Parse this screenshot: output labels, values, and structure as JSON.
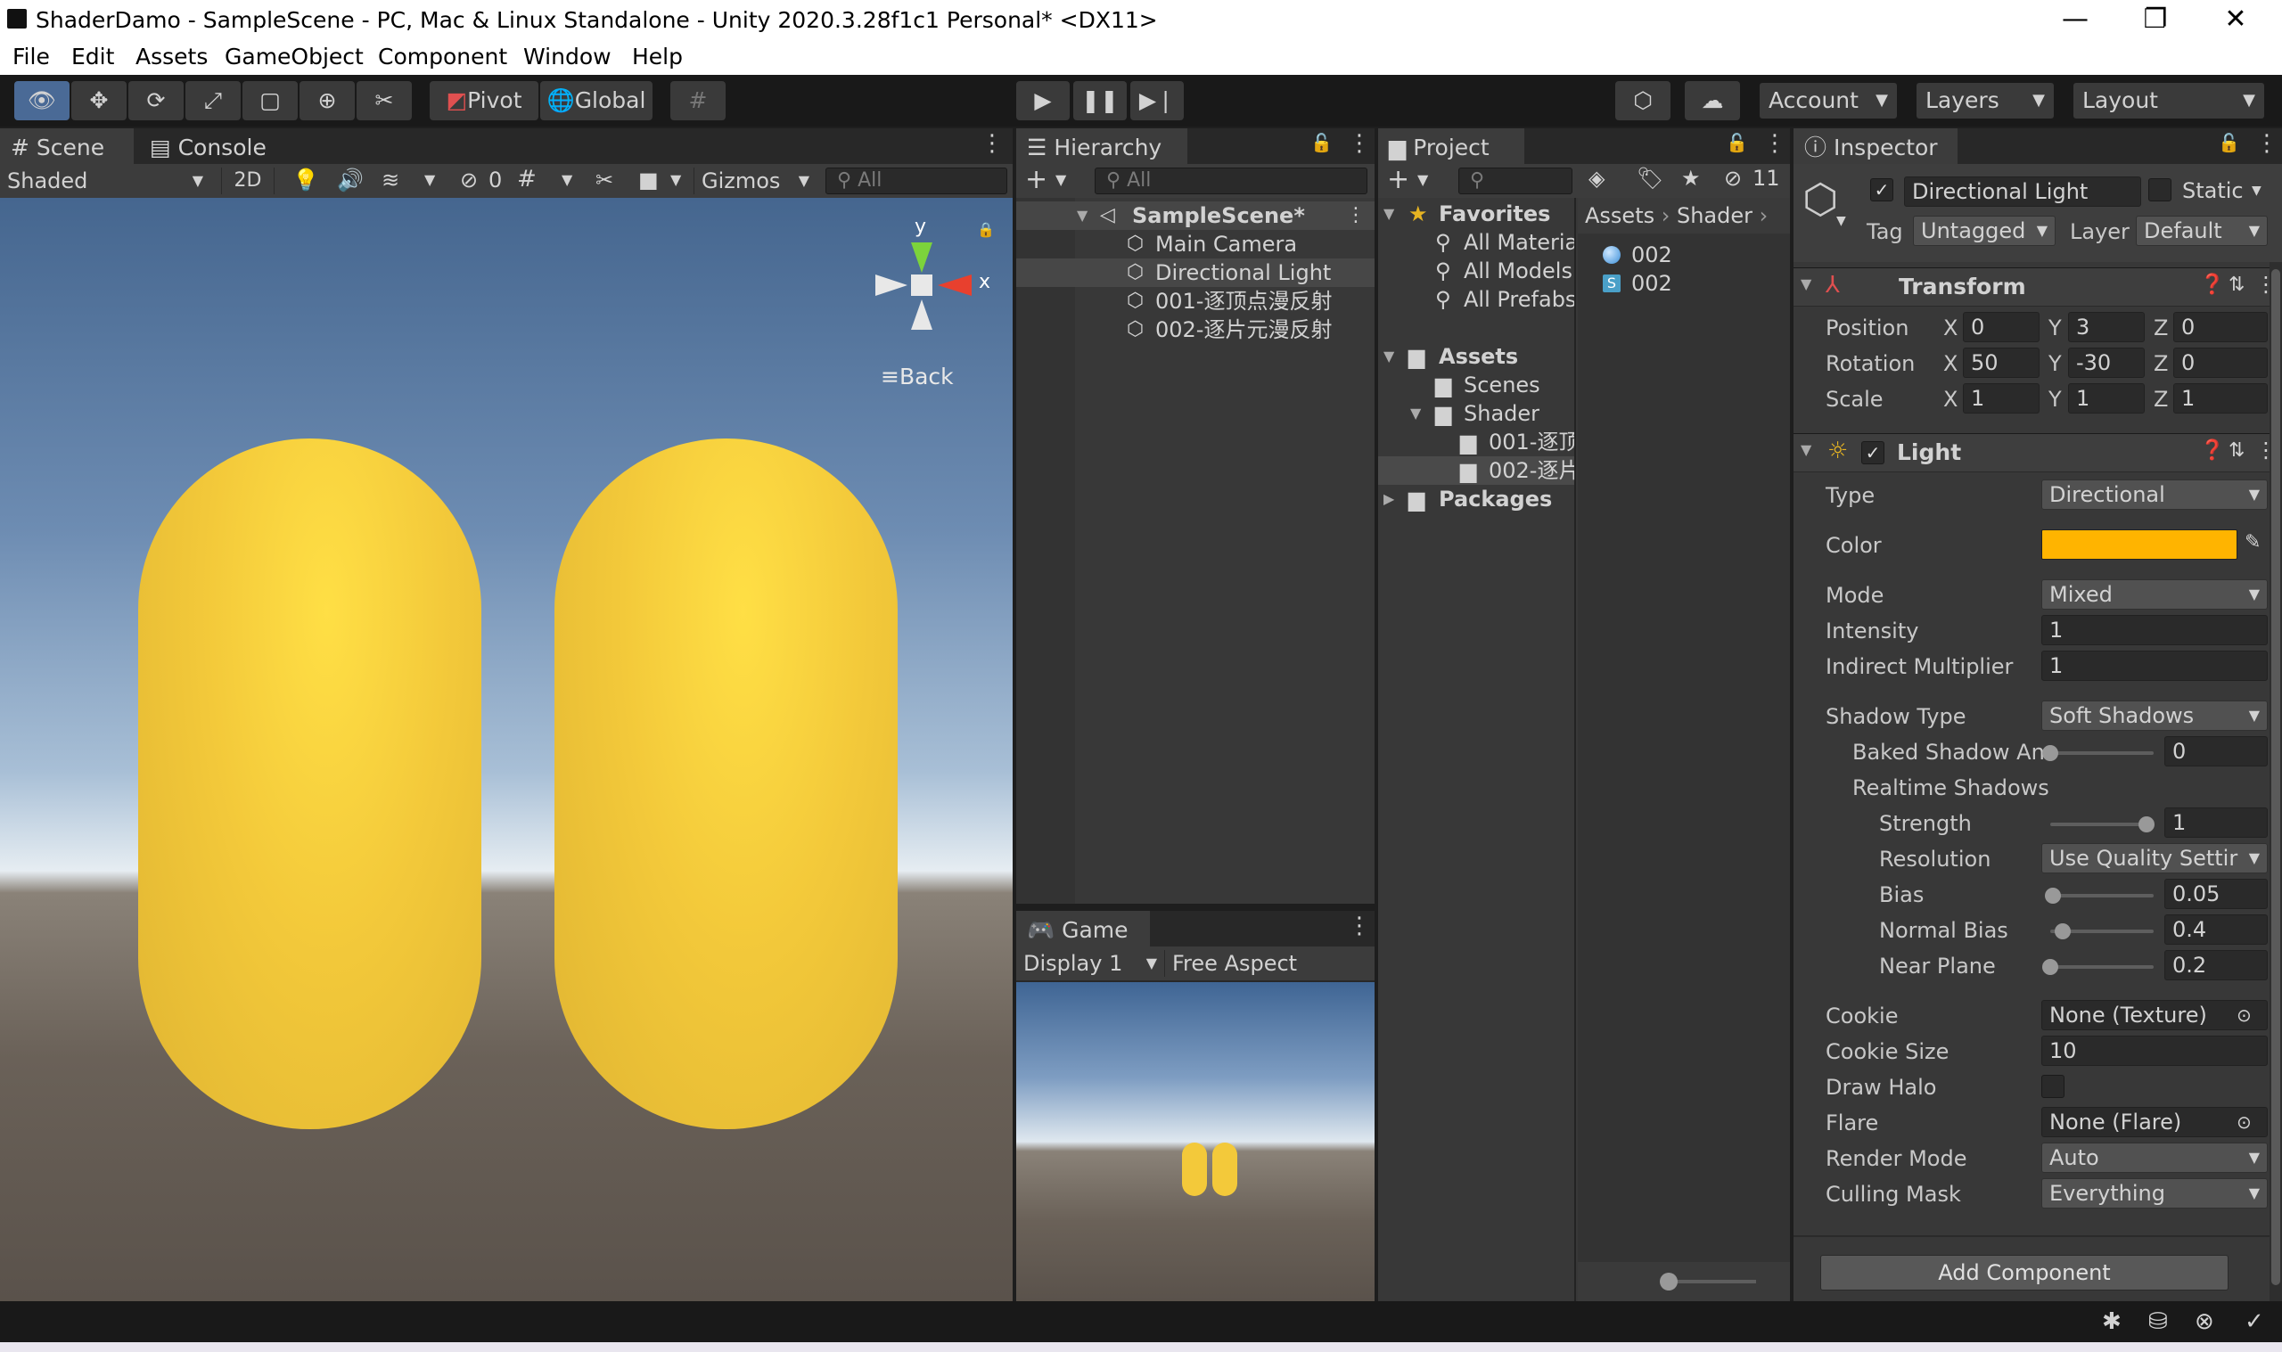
{
  "window": {
    "title": "ShaderDamo - SampleScene - PC, Mac & Linux Standalone - Unity 2020.3.28f1c1 Personal* <DX11>",
    "minimize": "—",
    "maximize": "❐",
    "close": "✕"
  },
  "menu": [
    "File",
    "Edit",
    "Assets",
    "GameObject",
    "Component",
    "Window",
    "Help"
  ],
  "toolbar": {
    "pivot": "Pivot",
    "global": "Global",
    "account": "Account",
    "layers": "Layers",
    "layout": "Layout"
  },
  "scene_panel": {
    "tab_scene": "Scene",
    "tab_console": "Console",
    "shading": "Shaded",
    "mode_2d": "2D",
    "hidden_count": "0",
    "gizmos": "Gizmos",
    "search_placeholder": "All",
    "gizmo_y": "y",
    "gizmo_x": "x",
    "view_label": "Back",
    "capsule_color": "#f5c93a"
  },
  "hierarchy": {
    "tab": "Hierarchy",
    "search_placeholder": "All",
    "scene": "SampleScene*",
    "items": [
      "Main Camera",
      "Directional Light",
      "001-逐顶点漫反射",
      "002-逐片元漫反射"
    ]
  },
  "game_panel": {
    "tab": "Game",
    "display": "Display 1",
    "aspect": "Free Aspect"
  },
  "project": {
    "tab": "Project",
    "hidden_count": "11",
    "favorites": "Favorites",
    "favorite_items": [
      "All Materia",
      "All Models",
      "All Prefabs"
    ],
    "assets": "Assets",
    "asset_folders": [
      "Scenes",
      "Shader"
    ],
    "shader_folders": [
      "001-逐顶",
      "002-逐片"
    ],
    "packages": "Packages",
    "breadcrumb": [
      "Assets",
      "Shader"
    ],
    "files": [
      "002",
      "002"
    ]
  },
  "inspector": {
    "tab": "Inspector",
    "object_name": "Directional Light",
    "static_label": "Static",
    "tag_label": "Tag",
    "tag_value": "Untagged",
    "layer_label": "Layer",
    "layer_value": "Default",
    "transform": {
      "title": "Transform",
      "position_label": "Position",
      "rotation_label": "Rotation",
      "scale_label": "Scale",
      "x": "X",
      "y": "Y",
      "z": "Z",
      "position": [
        "0",
        "3",
        "0"
      ],
      "rotation": [
        "50",
        "-30",
        "0"
      ],
      "scale": [
        "1",
        "1",
        "1"
      ]
    },
    "light": {
      "title": "Light",
      "type_label": "Type",
      "type_value": "Directional",
      "color_label": "Color",
      "color_value": "#ffb400",
      "mode_label": "Mode",
      "mode_value": "Mixed",
      "intensity_label": "Intensity",
      "intensity_value": "1",
      "indirect_label": "Indirect Multiplier",
      "indirect_value": "1",
      "shadow_type_label": "Shadow Type",
      "shadow_type_value": "Soft Shadows",
      "baked_angle_label": "Baked Shadow An",
      "baked_angle_value": "0",
      "baked_angle_fraction": 0.0,
      "realtime_label": "Realtime Shadows",
      "strength_label": "Strength",
      "strength_value": "1",
      "strength_fraction": 1.0,
      "resolution_label": "Resolution",
      "resolution_value": "Use Quality Settir",
      "bias_label": "Bias",
      "bias_value": "0.05",
      "bias_fraction": 0.025,
      "normal_bias_label": "Normal Bias",
      "normal_bias_value": "0.4",
      "normal_bias_fraction": 0.13,
      "near_plane_label": "Near Plane",
      "near_plane_value": "0.2",
      "near_plane_fraction": 0.0,
      "cookie_label": "Cookie",
      "cookie_value": "None (Texture)",
      "cookie_size_label": "Cookie Size",
      "cookie_size_value": "10",
      "draw_halo_label": "Draw Halo",
      "flare_label": "Flare",
      "flare_value": "None (Flare)",
      "render_mode_label": "Render Mode",
      "render_mode_value": "Auto",
      "culling_label": "Culling Mask",
      "culling_value": "Everything"
    },
    "add_component": "Add Component"
  }
}
